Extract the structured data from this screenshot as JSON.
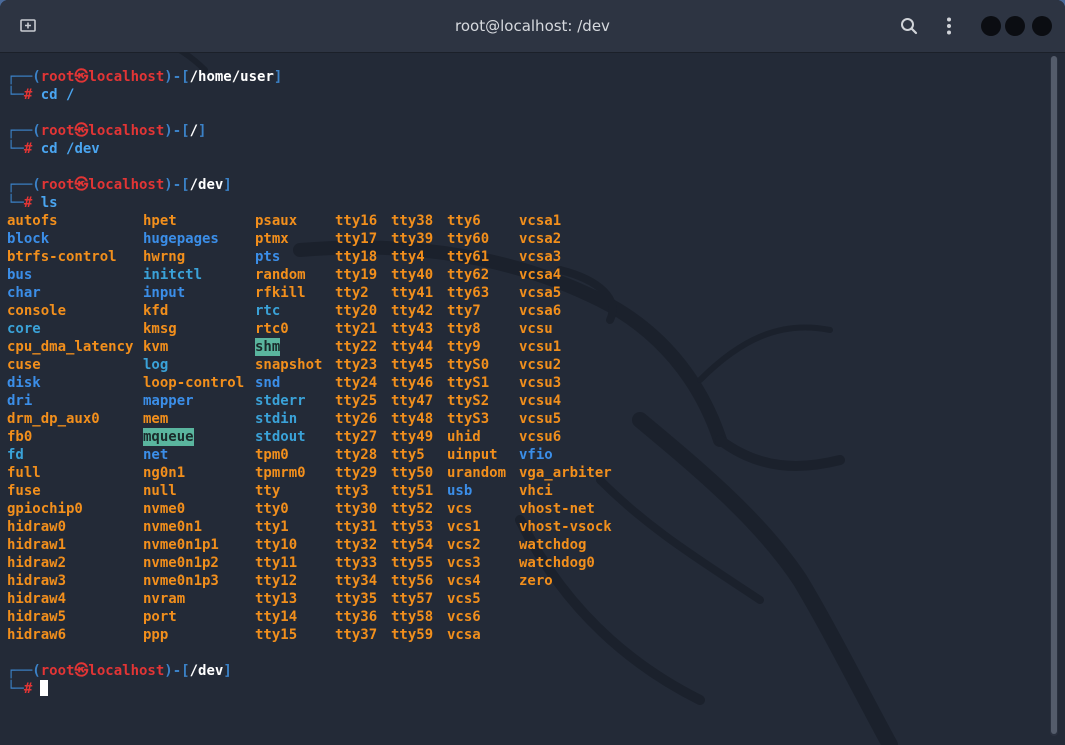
{
  "window": {
    "title": "root@localhost: /dev"
  },
  "icons": {
    "new_tab": "new-tab-icon",
    "search": "search-icon",
    "menu": "vertical-dots-icon"
  },
  "colors": {
    "background": "#232a37",
    "prompt_frame": "#3b82c8",
    "prompt_user": "#e23535",
    "file": "#f28f1c",
    "directory": "#3b8ee8",
    "symlink": "#3aa2d8",
    "sticky_dir_bg": "#5ab59e"
  },
  "prompts": [
    {
      "frame_open": "┌──(",
      "user": "root㉿localhost",
      "frame_mid": ")-[",
      "path": "/home/user",
      "frame_close": "]",
      "corner": "└─",
      "hash": "#",
      "command": " cd /"
    },
    {
      "frame_open": "┌──(",
      "user": "root㉿localhost",
      "frame_mid": ")-[",
      "path": "/",
      "frame_close": "]",
      "corner": "└─",
      "hash": "#",
      "command": " cd /dev"
    },
    {
      "frame_open": "┌──(",
      "user": "root㉿localhost",
      "frame_mid": ")-[",
      "path": "/dev",
      "frame_close": "]",
      "corner": "└─",
      "hash": "#",
      "command": " ls"
    },
    {
      "frame_open": "┌──(",
      "user": "root㉿localhost",
      "frame_mid": ")-[",
      "path": "/dev",
      "frame_close": "]",
      "corner": "└─",
      "hash": "#",
      "command": ""
    }
  ],
  "ls_output": {
    "columns": [
      [
        {
          "t": "autofs",
          "c": "o"
        },
        {
          "t": "block",
          "c": "b"
        },
        {
          "t": "btrfs-control",
          "c": "o"
        },
        {
          "t": "bus",
          "c": "b"
        },
        {
          "t": "char",
          "c": "b"
        },
        {
          "t": "console",
          "c": "o"
        },
        {
          "t": "core",
          "c": "s"
        },
        {
          "t": "cpu_dma_latency",
          "c": "o"
        },
        {
          "t": "cuse",
          "c": "o"
        },
        {
          "t": "disk",
          "c": "b"
        },
        {
          "t": "dri",
          "c": "b"
        },
        {
          "t": "drm_dp_aux0",
          "c": "o"
        },
        {
          "t": "fb0",
          "c": "o"
        },
        {
          "t": "fd",
          "c": "s"
        },
        {
          "t": "full",
          "c": "o"
        },
        {
          "t": "fuse",
          "c": "o"
        },
        {
          "t": "gpiochip0",
          "c": "o"
        },
        {
          "t": "hidraw0",
          "c": "o"
        },
        {
          "t": "hidraw1",
          "c": "o"
        },
        {
          "t": "hidraw2",
          "c": "o"
        },
        {
          "t": "hidraw3",
          "c": "o"
        },
        {
          "t": "hidraw4",
          "c": "o"
        },
        {
          "t": "hidraw5",
          "c": "o"
        },
        {
          "t": "hidraw6",
          "c": "o"
        }
      ],
      [
        {
          "t": "hpet",
          "c": "o"
        },
        {
          "t": "hugepages",
          "c": "b"
        },
        {
          "t": "hwrng",
          "c": "o"
        },
        {
          "t": "initctl",
          "c": "s"
        },
        {
          "t": "input",
          "c": "b"
        },
        {
          "t": "kfd",
          "c": "o"
        },
        {
          "t": "kmsg",
          "c": "o"
        },
        {
          "t": "kvm",
          "c": "o"
        },
        {
          "t": "log",
          "c": "s"
        },
        {
          "t": "loop-control",
          "c": "o"
        },
        {
          "t": "mapper",
          "c": "b"
        },
        {
          "t": "mem",
          "c": "o"
        },
        {
          "t": "mqueue",
          "c": "h"
        },
        {
          "t": "net",
          "c": "b"
        },
        {
          "t": "ng0n1",
          "c": "o"
        },
        {
          "t": "null",
          "c": "o"
        },
        {
          "t": "nvme0",
          "c": "o"
        },
        {
          "t": "nvme0n1",
          "c": "o"
        },
        {
          "t": "nvme0n1p1",
          "c": "o"
        },
        {
          "t": "nvme0n1p2",
          "c": "o"
        },
        {
          "t": "nvme0n1p3",
          "c": "o"
        },
        {
          "t": "nvram",
          "c": "o"
        },
        {
          "t": "port",
          "c": "o"
        },
        {
          "t": "ppp",
          "c": "o"
        }
      ],
      [
        {
          "t": "psaux",
          "c": "o"
        },
        {
          "t": "ptmx",
          "c": "o"
        },
        {
          "t": "pts",
          "c": "b"
        },
        {
          "t": "random",
          "c": "o"
        },
        {
          "t": "rfkill",
          "c": "o"
        },
        {
          "t": "rtc",
          "c": "s"
        },
        {
          "t": "rtc0",
          "c": "o"
        },
        {
          "t": "shm",
          "c": "h"
        },
        {
          "t": "snapshot",
          "c": "o"
        },
        {
          "t": "snd",
          "c": "b"
        },
        {
          "t": "stderr",
          "c": "s"
        },
        {
          "t": "stdin",
          "c": "s"
        },
        {
          "t": "stdout",
          "c": "s"
        },
        {
          "t": "tpm0",
          "c": "o"
        },
        {
          "t": "tpmrm0",
          "c": "o"
        },
        {
          "t": "tty",
          "c": "o"
        },
        {
          "t": "tty0",
          "c": "o"
        },
        {
          "t": "tty1",
          "c": "o"
        },
        {
          "t": "tty10",
          "c": "o"
        },
        {
          "t": "tty11",
          "c": "o"
        },
        {
          "t": "tty12",
          "c": "o"
        },
        {
          "t": "tty13",
          "c": "o"
        },
        {
          "t": "tty14",
          "c": "o"
        },
        {
          "t": "tty15",
          "c": "o"
        }
      ],
      [
        {
          "t": "tty16",
          "c": "o"
        },
        {
          "t": "tty17",
          "c": "o"
        },
        {
          "t": "tty18",
          "c": "o"
        },
        {
          "t": "tty19",
          "c": "o"
        },
        {
          "t": "tty2",
          "c": "o"
        },
        {
          "t": "tty20",
          "c": "o"
        },
        {
          "t": "tty21",
          "c": "o"
        },
        {
          "t": "tty22",
          "c": "o"
        },
        {
          "t": "tty23",
          "c": "o"
        },
        {
          "t": "tty24",
          "c": "o"
        },
        {
          "t": "tty25",
          "c": "o"
        },
        {
          "t": "tty26",
          "c": "o"
        },
        {
          "t": "tty27",
          "c": "o"
        },
        {
          "t": "tty28",
          "c": "o"
        },
        {
          "t": "tty29",
          "c": "o"
        },
        {
          "t": "tty3",
          "c": "o"
        },
        {
          "t": "tty30",
          "c": "o"
        },
        {
          "t": "tty31",
          "c": "o"
        },
        {
          "t": "tty32",
          "c": "o"
        },
        {
          "t": "tty33",
          "c": "o"
        },
        {
          "t": "tty34",
          "c": "o"
        },
        {
          "t": "tty35",
          "c": "o"
        },
        {
          "t": "tty36",
          "c": "o"
        },
        {
          "t": "tty37",
          "c": "o"
        }
      ],
      [
        {
          "t": "tty38",
          "c": "o"
        },
        {
          "t": "tty39",
          "c": "o"
        },
        {
          "t": "tty4",
          "c": "o"
        },
        {
          "t": "tty40",
          "c": "o"
        },
        {
          "t": "tty41",
          "c": "o"
        },
        {
          "t": "tty42",
          "c": "o"
        },
        {
          "t": "tty43",
          "c": "o"
        },
        {
          "t": "tty44",
          "c": "o"
        },
        {
          "t": "tty45",
          "c": "o"
        },
        {
          "t": "tty46",
          "c": "o"
        },
        {
          "t": "tty47",
          "c": "o"
        },
        {
          "t": "tty48",
          "c": "o"
        },
        {
          "t": "tty49",
          "c": "o"
        },
        {
          "t": "tty5",
          "c": "o"
        },
        {
          "t": "tty50",
          "c": "o"
        },
        {
          "t": "tty51",
          "c": "o"
        },
        {
          "t": "tty52",
          "c": "o"
        },
        {
          "t": "tty53",
          "c": "o"
        },
        {
          "t": "tty54",
          "c": "o"
        },
        {
          "t": "tty55",
          "c": "o"
        },
        {
          "t": "tty56",
          "c": "o"
        },
        {
          "t": "tty57",
          "c": "o"
        },
        {
          "t": "tty58",
          "c": "o"
        },
        {
          "t": "tty59",
          "c": "o"
        }
      ],
      [
        {
          "t": "tty6",
          "c": "o"
        },
        {
          "t": "tty60",
          "c": "o"
        },
        {
          "t": "tty61",
          "c": "o"
        },
        {
          "t": "tty62",
          "c": "o"
        },
        {
          "t": "tty63",
          "c": "o"
        },
        {
          "t": "tty7",
          "c": "o"
        },
        {
          "t": "tty8",
          "c": "o"
        },
        {
          "t": "tty9",
          "c": "o"
        },
        {
          "t": "ttyS0",
          "c": "o"
        },
        {
          "t": "ttyS1",
          "c": "o"
        },
        {
          "t": "ttyS2",
          "c": "o"
        },
        {
          "t": "ttyS3",
          "c": "o"
        },
        {
          "t": "uhid",
          "c": "o"
        },
        {
          "t": "uinput",
          "c": "o"
        },
        {
          "t": "urandom",
          "c": "o"
        },
        {
          "t": "usb",
          "c": "b"
        },
        {
          "t": "vcs",
          "c": "o"
        },
        {
          "t": "vcs1",
          "c": "o"
        },
        {
          "t": "vcs2",
          "c": "o"
        },
        {
          "t": "vcs3",
          "c": "o"
        },
        {
          "t": "vcs4",
          "c": "o"
        },
        {
          "t": "vcs5",
          "c": "o"
        },
        {
          "t": "vcs6",
          "c": "o"
        },
        {
          "t": "vcsa",
          "c": "o"
        }
      ],
      [
        {
          "t": "vcsa1",
          "c": "o"
        },
        {
          "t": "vcsa2",
          "c": "o"
        },
        {
          "t": "vcsa3",
          "c": "o"
        },
        {
          "t": "vcsa4",
          "c": "o"
        },
        {
          "t": "vcsa5",
          "c": "o"
        },
        {
          "t": "vcsa6",
          "c": "o"
        },
        {
          "t": "vcsu",
          "c": "o"
        },
        {
          "t": "vcsu1",
          "c": "o"
        },
        {
          "t": "vcsu2",
          "c": "o"
        },
        {
          "t": "vcsu3",
          "c": "o"
        },
        {
          "t": "vcsu4",
          "c": "o"
        },
        {
          "t": "vcsu5",
          "c": "o"
        },
        {
          "t": "vcsu6",
          "c": "o"
        },
        {
          "t": "vfio",
          "c": "b"
        },
        {
          "t": "vga_arbiter",
          "c": "o"
        },
        {
          "t": "vhci",
          "c": "o"
        },
        {
          "t": "vhost-net",
          "c": "o"
        },
        {
          "t": "vhost-vsock",
          "c": "o"
        },
        {
          "t": "watchdog",
          "c": "o"
        },
        {
          "t": "watchdog0",
          "c": "o"
        },
        {
          "t": "zero",
          "c": "o"
        }
      ]
    ]
  }
}
